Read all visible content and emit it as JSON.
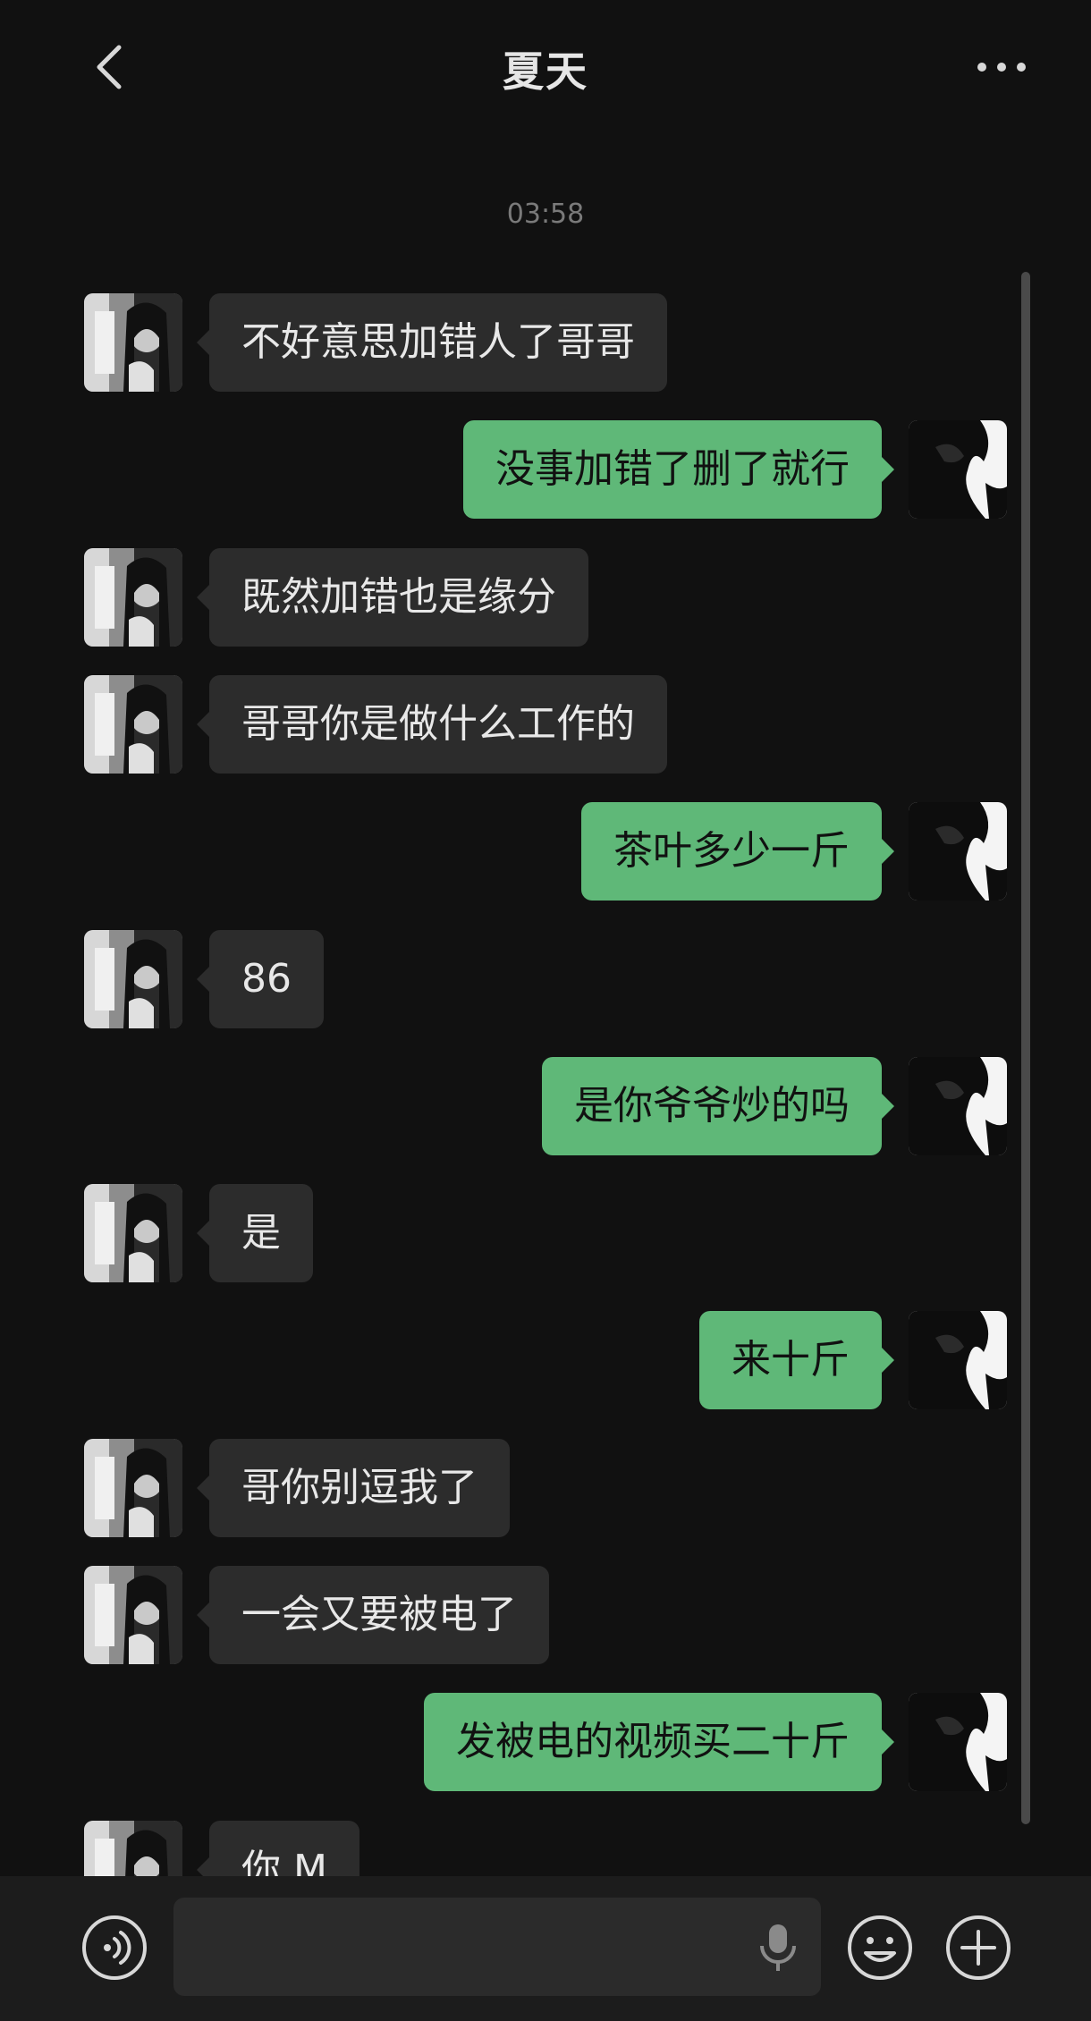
{
  "header": {
    "title": "夏天",
    "back_icon": "chevron-left-icon",
    "more_icon": "more-dots-icon"
  },
  "timestamp": "03:58",
  "messages": [
    {
      "side": "left",
      "text": "不好意思加错人了哥哥"
    },
    {
      "side": "right",
      "text": "没事加错了删了就行"
    },
    {
      "side": "left",
      "text": "既然加错也是缘分"
    },
    {
      "side": "left",
      "text": "哥哥你是做什么工作的"
    },
    {
      "side": "right",
      "text": "茶叶多少一斤"
    },
    {
      "side": "left",
      "text": "86"
    },
    {
      "side": "right",
      "text": "是你爷爷炒的吗"
    },
    {
      "side": "left",
      "text": "是"
    },
    {
      "side": "right",
      "text": "来十斤"
    },
    {
      "side": "left",
      "text": "哥你别逗我了"
    },
    {
      "side": "left",
      "text": "一会又要被电了"
    },
    {
      "side": "right",
      "text": "发被电的视频买二十斤"
    },
    {
      "side": "left",
      "text": "你 M"
    }
  ],
  "input": {
    "voice_icon": "voice-icon",
    "mic_icon": "microphone-icon",
    "emoji_icon": "emoji-icon",
    "plus_icon": "plus-icon",
    "value": "",
    "placeholder": ""
  },
  "colors": {
    "background": "#111111",
    "bubble_left": "#2c2c2c",
    "bubble_right": "#5fb878",
    "text_light": "#e8e8e8"
  }
}
